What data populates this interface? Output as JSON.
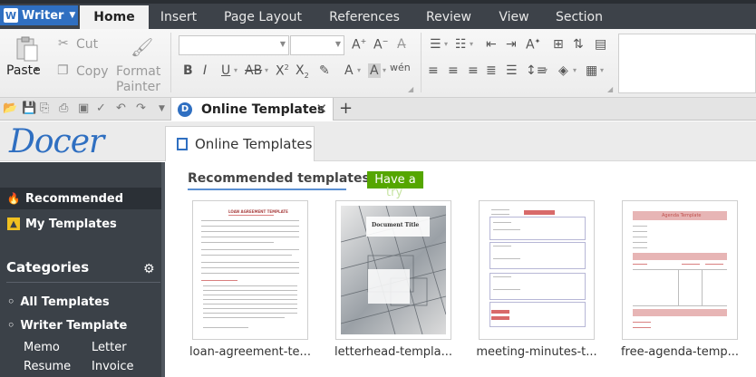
{
  "app": {
    "name": "Writer",
    "logo_letter": "W"
  },
  "menu": {
    "tabs": [
      {
        "label": "Home",
        "active": true
      },
      {
        "label": "Insert"
      },
      {
        "label": "Page Layout"
      },
      {
        "label": "References"
      },
      {
        "label": "Review"
      },
      {
        "label": "View"
      },
      {
        "label": "Section"
      }
    ]
  },
  "ribbon": {
    "paste": "Paste",
    "cut": "Cut",
    "copy": "Copy",
    "format_painter_1": "Format",
    "format_painter_2": "Painter",
    "font_name": "",
    "font_size": ""
  },
  "doc_tab": {
    "title": "Online Templates",
    "icon_letter": "D",
    "close": "✕",
    "add": "+"
  },
  "docer": {
    "logo": "Docer",
    "online_tab": "Online Templates"
  },
  "sidebar": {
    "items": [
      {
        "label": "Recommended",
        "icon": "flame-icon",
        "active": true
      },
      {
        "label": "My Templates",
        "icon": "user-icon"
      }
    ],
    "categories_title": "Categories",
    "categories": [
      "All Templates",
      "Writer Template"
    ],
    "subcategories": [
      "Memo",
      "Letter",
      "Resume",
      "Invoice"
    ]
  },
  "main": {
    "section_title": "Recommended templates",
    "have_button": "Have a",
    "have_button_overflow": "try",
    "templates": [
      {
        "label": "loan-agreement-te...",
        "doc_title": "LOAN AGREEMENT TEMPLATE"
      },
      {
        "label": "letterhead-templa...",
        "doc_title": "Document Title"
      },
      {
        "label": "meeting-minutes-t...",
        "doc_title": ""
      },
      {
        "label": "free-agenda-temp...",
        "doc_title": "Agenda Template"
      }
    ]
  },
  "colors": {
    "accent": "#2f6fc1",
    "menubar": "#3d4249",
    "sidebar": "#3b4148",
    "green_button": "#55a600"
  }
}
